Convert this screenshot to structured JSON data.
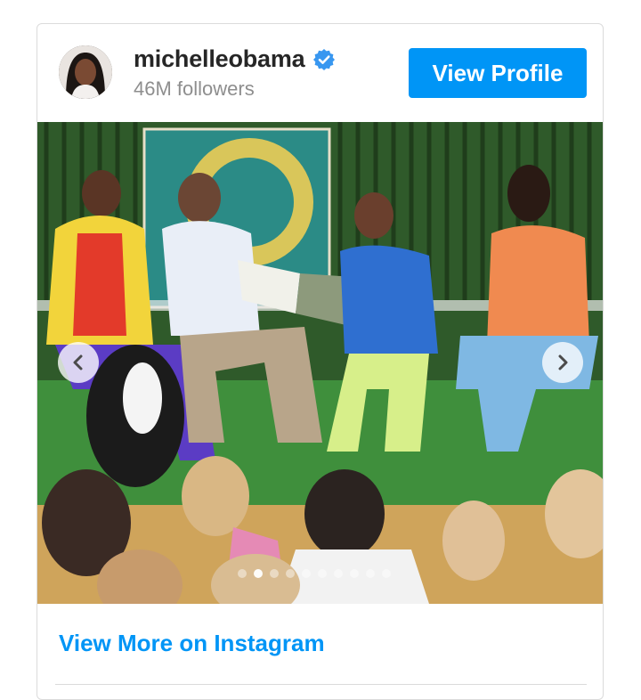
{
  "profile": {
    "username": "michelleobama",
    "followers": "46M followers",
    "verified": true,
    "view_profile_label": "View Profile"
  },
  "post": {
    "carousel_total": 10,
    "carousel_active_index": 1
  },
  "footer": {
    "view_more_label": "View More on Instagram"
  },
  "colors": {
    "accent": "#0095f6",
    "username_text": "#262626",
    "muted_text": "#8e8e8e",
    "border": "#dbdbdb"
  },
  "icons": {
    "verified": "verified-badge-icon",
    "prev": "chevron-left-icon",
    "next": "chevron-right-icon"
  }
}
